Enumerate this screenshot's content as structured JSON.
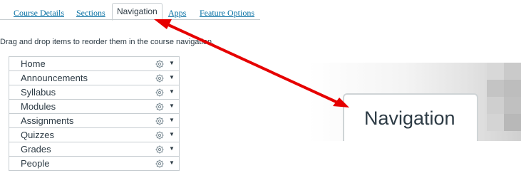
{
  "tabs": [
    {
      "label": "Course Details",
      "active": false
    },
    {
      "label": "Sections",
      "active": false
    },
    {
      "label": "Navigation",
      "active": true
    },
    {
      "label": "Apps",
      "active": false
    },
    {
      "label": "Feature Options",
      "active": false
    }
  ],
  "instructions": "Drag and drop items to reorder them in the course navigation.",
  "nav_items": [
    {
      "label": "Home"
    },
    {
      "label": "Announcements"
    },
    {
      "label": "Syllabus"
    },
    {
      "label": "Modules"
    },
    {
      "label": "Assignments"
    },
    {
      "label": "Quizzes"
    },
    {
      "label": "Grades"
    },
    {
      "label": "People"
    }
  ],
  "icons": {
    "settings": "gear-icon",
    "menu": "caret-down-icon"
  },
  "zoom_callout": {
    "label": "Navigation"
  },
  "colors": {
    "link": "#0770a3",
    "text": "#2d3b45",
    "border": "#c7cdd1",
    "annotation_arrow": "#e60000"
  }
}
